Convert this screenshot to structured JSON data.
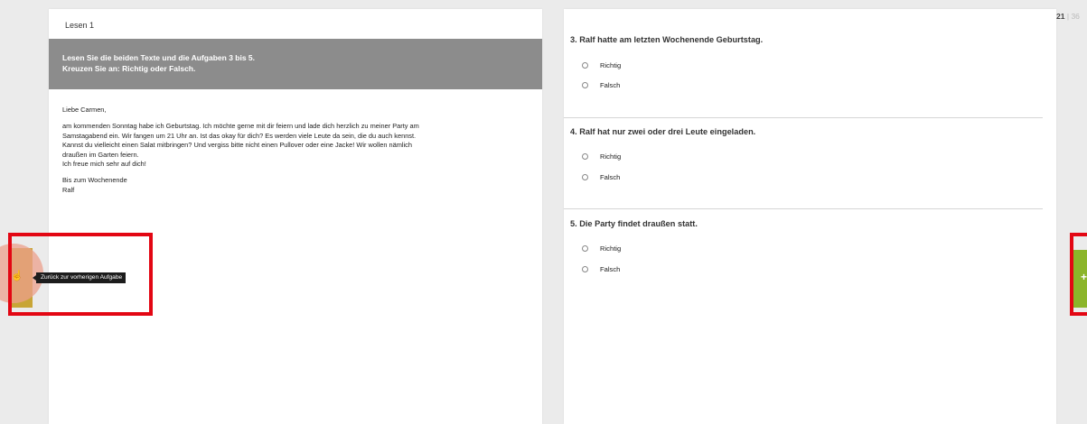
{
  "left": {
    "section_label": "Lesen 1",
    "instruction_line1": "Lesen Sie die beiden Texte und die Aufgaben 3 bis 5.",
    "instruction_line2": "Kreuzen Sie an: Richtig oder Falsch.",
    "letter": {
      "greeting": "Liebe Carmen,",
      "body_line1": "am kommenden Sonntag habe ich Geburtstag. Ich möchte gerne mit dir feiern und lade dich herzlich zu meiner Party am",
      "body_line2": "Samstagabend ein. Wir fangen um 21 Uhr an. Ist das okay für dich? Es werden viele Leute da sein, die du auch kennst.",
      "body_line3": "Kannst du vielleicht einen Salat mitbringen? Und vergiss bitte nicht einen Pullover oder eine Jacke! Wir wollen nämlich",
      "body_line4": "draußen im Garten feiern.",
      "body_line5": "Ich freue mich sehr auf dich!",
      "closing": "Bis zum Wochenende",
      "signature": "Ralf"
    }
  },
  "right": {
    "page_counter": {
      "current": "21",
      "separator": "|",
      "total": "36"
    },
    "questions": [
      {
        "title": "3. Ralf hatte am letzten Wochenende Geburtstag.",
        "options": [
          "Richtig",
          "Falsch"
        ]
      },
      {
        "title": "4. Ralf hat nur zwei oder drei Leute eingeladen.",
        "options": [
          "Richtig",
          "Falsch"
        ]
      },
      {
        "title": "5. Die Party findet draußen statt.",
        "options": [
          "Richtig",
          "Falsch"
        ]
      }
    ]
  },
  "nav": {
    "back_tooltip": "Zurück zur vorherigen Aufgabe",
    "back_icon": "hand-pointer-icon",
    "next_icon": "plus-icon",
    "back_color": "#c8a535",
    "next_color": "#8bb52a"
  },
  "annotation": {
    "highlight_color": "#e30613"
  }
}
